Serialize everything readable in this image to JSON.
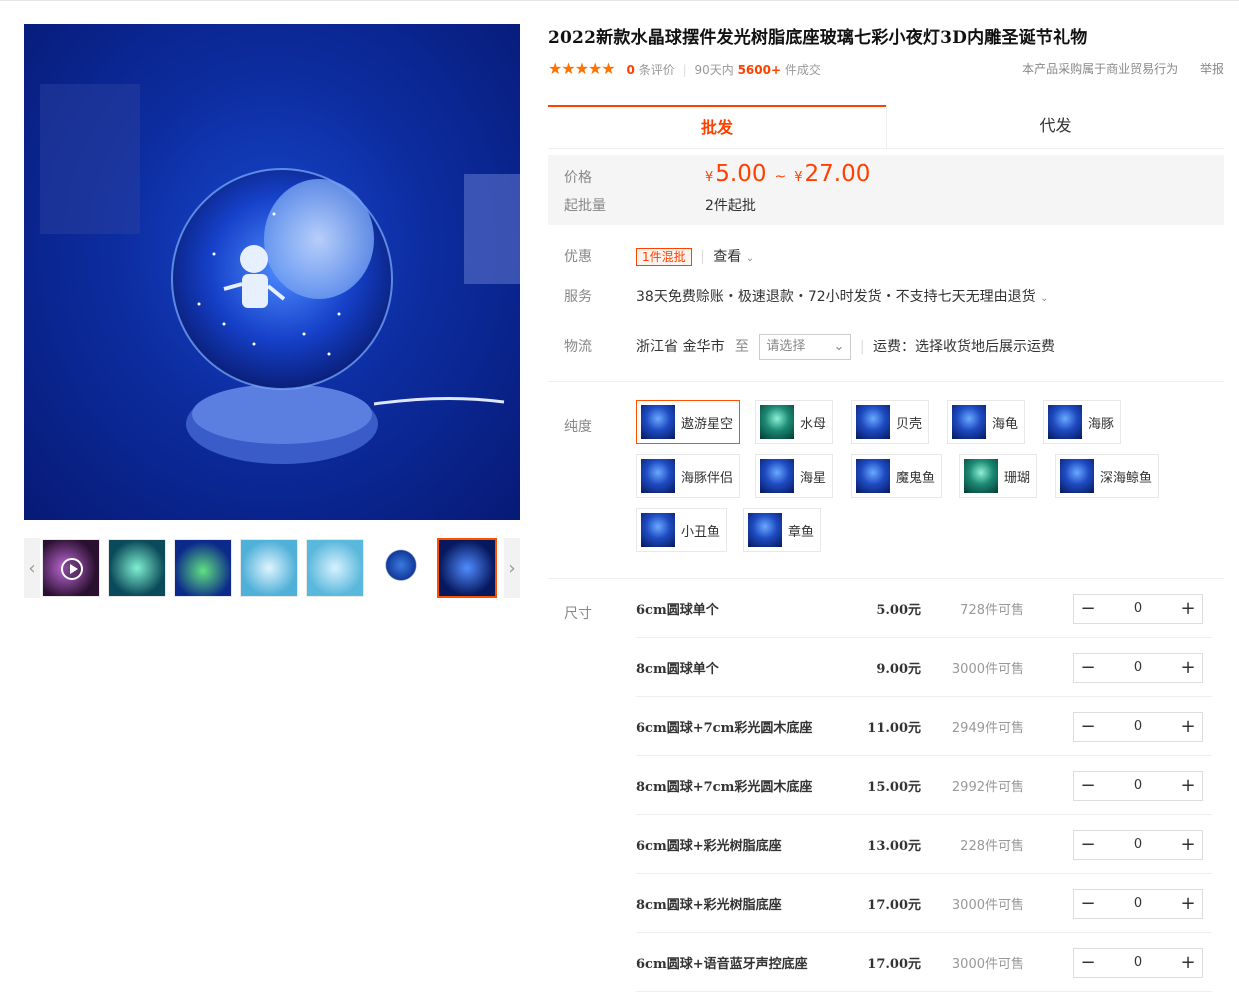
{
  "product": {
    "title": "2022新款水晶球摆件发光树脂底座玻璃七彩小夜灯3D内雕圣诞节礼物",
    "stars": "★★★★★",
    "review_count": "0",
    "review_label": "条评价",
    "sales_prefix": "90天内",
    "sales_count": "5600+",
    "sales_suffix": "件成交",
    "notice": "本产品采购属于商业贸易行为",
    "report": "举报"
  },
  "tabs": [
    {
      "label": "批发",
      "active": true
    },
    {
      "label": "代发",
      "active": false
    }
  ],
  "price": {
    "label": "价格",
    "currency": "¥",
    "min": "5.00",
    "tilde": "~",
    "max": "27.00",
    "moq_label": "起批量",
    "moq_value": "2件起批"
  },
  "promo": {
    "label": "优惠",
    "tag": "1件混批",
    "view": "查看"
  },
  "service": {
    "label": "服务",
    "text": "38天免费赊账・极速退款・72小时发货・不支持七天无理由退货"
  },
  "logistics": {
    "label": "物流",
    "origin": "浙江省 金华市",
    "to": "至",
    "select_placeholder": "请选择",
    "freight": "运费：选择收货地后展示运费"
  },
  "purity": {
    "label": "纯度",
    "options": [
      "遨游星空",
      "水母",
      "贝壳",
      "海龟",
      "海豚",
      "海豚伴侣",
      "海星",
      "魔鬼鱼",
      "珊瑚",
      "深海鲸鱼",
      "小丑鱼",
      "章鱼"
    ],
    "selected": "遨游星空"
  },
  "sizes": {
    "label": "尺寸",
    "rows": [
      {
        "name": "6cm圆球单个",
        "price": "5.00元",
        "stock": "728件可售",
        "qty": "0"
      },
      {
        "name": "8cm圆球单个",
        "price": "9.00元",
        "stock": "3000件可售",
        "qty": "0"
      },
      {
        "name": "6cm圆球+7cm彩光圆木底座",
        "price": "11.00元",
        "stock": "2949件可售",
        "qty": "0"
      },
      {
        "name": "8cm圆球+7cm彩光圆木底座",
        "price": "15.00元",
        "stock": "2992件可售",
        "qty": "0"
      },
      {
        "name": "6cm圆球+彩光树脂底座",
        "price": "13.00元",
        "stock": "228件可售",
        "qty": "0"
      },
      {
        "name": "8cm圆球+彩光树脂底座",
        "price": "17.00元",
        "stock": "3000件可售",
        "qty": "0"
      },
      {
        "name": "6cm圆球+语音蓝牙声控底座",
        "price": "17.00元",
        "stock": "3000件可售",
        "qty": "0"
      }
    ],
    "minus": "−",
    "plus": "+"
  },
  "gallery": {
    "prev": "‹",
    "next": "›"
  },
  "colors": {
    "accent": "#ff4000",
    "active_border": "#ff5000"
  }
}
